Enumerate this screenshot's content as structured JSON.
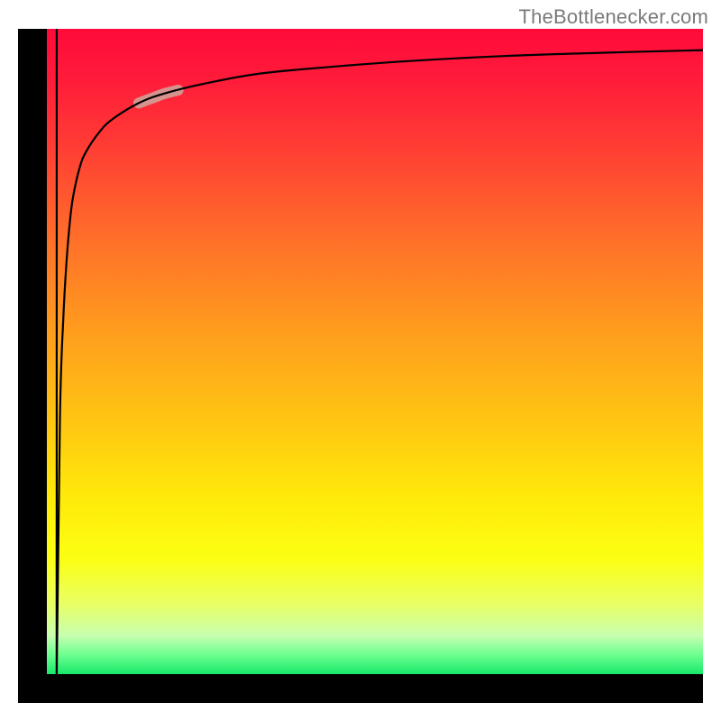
{
  "watermark": {
    "text": "TheBottlenecker.com"
  },
  "chart_data": {
    "type": "line",
    "title": "",
    "xlabel": "",
    "ylabel": "",
    "xlim": [
      0,
      100
    ],
    "ylim": [
      0,
      100
    ],
    "gradient_stops": [
      {
        "position": 0,
        "color": "#ff0a3a"
      },
      {
        "position": 8,
        "color": "#ff1c3a"
      },
      {
        "position": 18,
        "color": "#ff3c34"
      },
      {
        "position": 32,
        "color": "#ff6d2a"
      },
      {
        "position": 46,
        "color": "#ff9a1e"
      },
      {
        "position": 60,
        "color": "#ffc313"
      },
      {
        "position": 72,
        "color": "#ffe80a"
      },
      {
        "position": 82,
        "color": "#fcff12"
      },
      {
        "position": 89,
        "color": "#e9ff63"
      },
      {
        "position": 94,
        "color": "#c8ffb0"
      },
      {
        "position": 97,
        "color": "#6dff8f"
      },
      {
        "position": 100,
        "color": "#18e86a"
      }
    ],
    "series": [
      {
        "name": "bottleneck-curve",
        "x": [
          1.5,
          2,
          2.5,
          3,
          3.5,
          4,
          5,
          6,
          8,
          10,
          14,
          18,
          24,
          32,
          42,
          55,
          70,
          85,
          100
        ],
        "y": [
          0,
          40,
          55,
          64,
          70,
          74,
          78.5,
          81,
          84,
          86,
          88.5,
          90,
          91.5,
          93,
          94,
          95,
          95.8,
          96.3,
          96.7
        ]
      }
    ],
    "highlight_segment": {
      "x_start": 14,
      "x_end": 20,
      "color": "#d39a92",
      "thickness": 12
    }
  }
}
